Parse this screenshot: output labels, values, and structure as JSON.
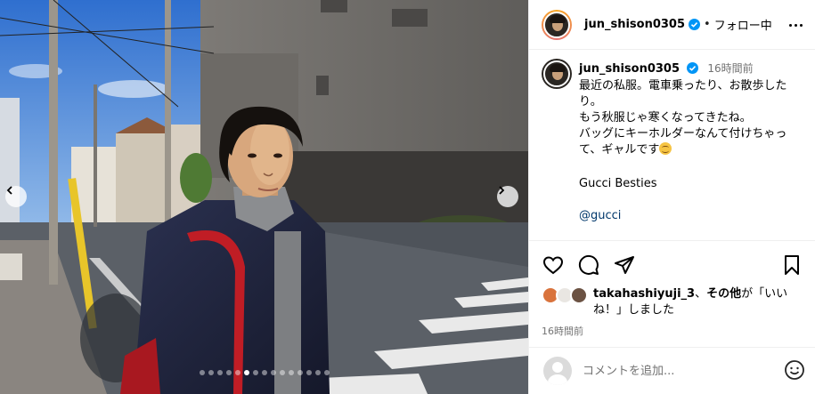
{
  "header": {
    "username": "jun_shison0305",
    "separator": "•",
    "follow_label": "フォロー中"
  },
  "caption": {
    "username": "jun_shison0305",
    "time": "16時間前",
    "text": "最近の私服。電車乗ったり、お散歩したり。\nもう秋服じゃ寒くなってきたね。\nバッグにキーホルダーなんて付けちゃって、ギャルです",
    "emoji": "grinning-face-with-sweat",
    "brand_line": "Gucci Besties",
    "mention": "@gucci"
  },
  "actions": {
    "like_icon": "heart-icon",
    "comment_icon": "comment-icon",
    "share_icon": "share-icon",
    "save_icon": "bookmark-icon"
  },
  "likes": {
    "liker": "takahashiyuji_3",
    "middle": "、",
    "others": "その他",
    "suffix": "が「いいね！」しました"
  },
  "post_time": "16時間前",
  "comment": {
    "placeholder": "コメントを追加..."
  },
  "carousel": {
    "total_slides": 15,
    "active_index": 5
  },
  "colors": {
    "verified_blue": "#0095f6",
    "link": "#00376b",
    "muted": "#737373"
  }
}
